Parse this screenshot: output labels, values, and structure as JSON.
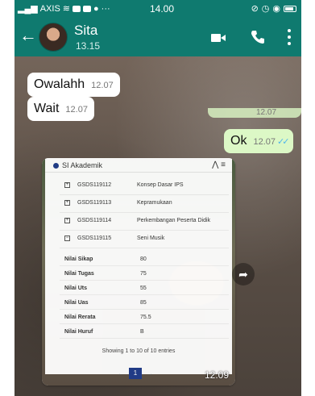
{
  "status_bar": {
    "carrier": "AXIS",
    "time": "14.00"
  },
  "header": {
    "contact_name": "Sita",
    "last_seen": "13.15"
  },
  "messages": [
    {
      "direction": "in",
      "text": "Owalahh",
      "time": "12.07"
    },
    {
      "direction": "in",
      "text": "Wait",
      "time": "12.07"
    },
    {
      "direction": "out",
      "text": "Ok",
      "time": "12.07",
      "ticks": "✓✓"
    }
  ],
  "partial_message": {
    "time": "12.07"
  },
  "image_message": {
    "time": "12.09",
    "webpage": {
      "app_title": "SI Akademik",
      "courses": [
        {
          "code": "GSDS119112",
          "name": "Konsep Dasar IPS",
          "check": "+"
        },
        {
          "code": "GSDS119113",
          "name": "Kepramukaan",
          "check": "+"
        },
        {
          "code": "GSDS119114",
          "name": "Perkembangan Peserta Didik",
          "check": "+"
        },
        {
          "code": "GSDS119115",
          "name": "Seni Musik",
          "check": "−"
        }
      ],
      "grades": [
        {
          "label": "Nilai Sikap",
          "value": "80"
        },
        {
          "label": "Nilai Tugas",
          "value": "75"
        },
        {
          "label": "Nilai Uts",
          "value": "55"
        },
        {
          "label": "Nilai Uas",
          "value": "85"
        },
        {
          "label": "Nilai Rerata",
          "value": "75.5"
        },
        {
          "label": "Nilai Huruf",
          "value": "B"
        }
      ],
      "entries_text": "Showing 1 to 10 of 10 entries",
      "pagination": {
        "prev": "←",
        "current": "1",
        "next": "→"
      }
    }
  },
  "colors": {
    "header_bg": "#0f7a6f",
    "outgoing_bubble": "#dcf8c6",
    "read_ticks": "#4fb6ec"
  }
}
